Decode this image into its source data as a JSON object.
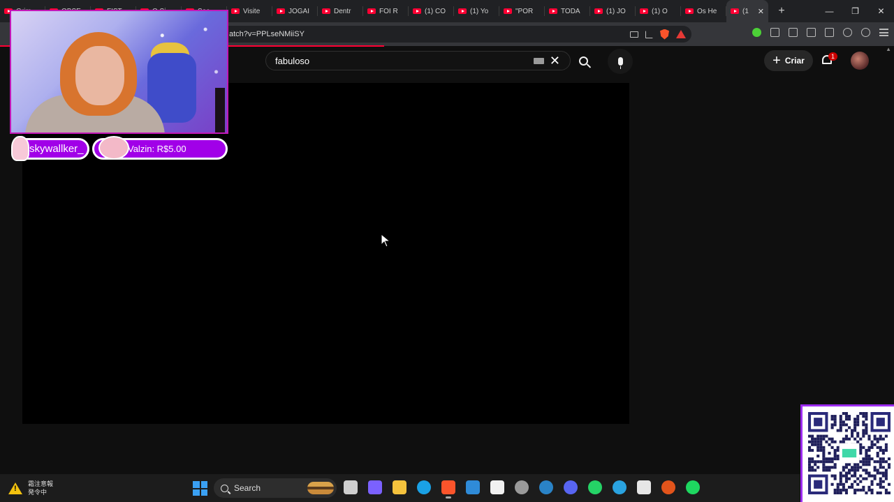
{
  "browser": {
    "tabs": [
      {
        "label": "Grim"
      },
      {
        "label": "OBSE"
      },
      {
        "label": "FIST"
      },
      {
        "label": "O Si"
      },
      {
        "label": "Sec"
      },
      {
        "label": "Visite"
      },
      {
        "label": "JOGAI"
      },
      {
        "label": "Dentr"
      },
      {
        "label": "FOI R"
      },
      {
        "label": "(1) CO"
      },
      {
        "label": "(1) Yo"
      },
      {
        "label": "\"POR"
      },
      {
        "label": "TODA"
      },
      {
        "label": "(1) JO"
      },
      {
        "label": "(1) O"
      },
      {
        "label": "Os He"
      },
      {
        "label": "(1"
      }
    ],
    "new_tab": "+",
    "window_controls": {
      "minimize": "—",
      "restore": "❐",
      "close": "✕"
    },
    "tab_close": "✕",
    "address": "atch?v=PPLseNMiiSY",
    "load_progress_percent": 43
  },
  "youtube": {
    "search_value": "fabuloso",
    "clear_glyph": "✕",
    "create_label": "Criar",
    "create_plus": "+",
    "notification_count": "1",
    "accent": "#ff0033"
  },
  "overlay": {
    "username": "skywallker_",
    "tip_text": "Valzin: R$5.00",
    "accent": "#a100e8"
  },
  "taskbar": {
    "weather_line1": "霜注意報",
    "weather_line2": "発令中",
    "search_label": "Search",
    "apps": [
      {
        "icon": "task-view-icon",
        "color": "#cfcfcf"
      },
      {
        "icon": "copilot-icon",
        "color": "#7b61ff"
      },
      {
        "icon": "file-explorer-icon",
        "color": "#f4c23d"
      },
      {
        "icon": "edge-icon",
        "color": "#1aa1e6"
      },
      {
        "icon": "brave-icon",
        "color": "#fb542b"
      },
      {
        "icon": "microsoft-store-icon",
        "color": "#2f8bd8"
      },
      {
        "icon": "capcut-icon",
        "color": "#f1f1f1"
      },
      {
        "icon": "obs-icon",
        "color": "#9a9a9a"
      },
      {
        "icon": "steam-icon",
        "color": "#2a83c7"
      },
      {
        "icon": "discord-icon",
        "color": "#5865f2"
      },
      {
        "icon": "whatsapp-icon",
        "color": "#25d366"
      },
      {
        "icon": "telegram-icon",
        "color": "#2aa3e0"
      },
      {
        "icon": "epic-games-icon",
        "color": "#e6e6e6"
      },
      {
        "icon": "brave-alt-icon",
        "color": "#e2541b"
      },
      {
        "icon": "spotify-icon",
        "color": "#1ed760"
      }
    ]
  }
}
